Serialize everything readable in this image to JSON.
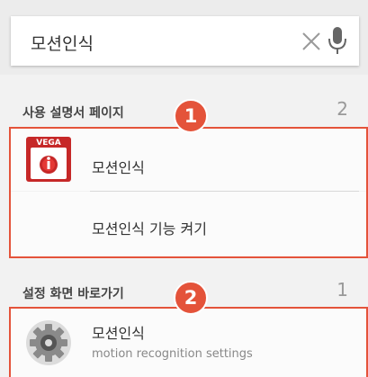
{
  "search": {
    "query": "모션인식"
  },
  "sections": [
    {
      "title": "사용 설명서 페이지",
      "count": "2",
      "badge": "1",
      "items": [
        {
          "label": "모션인식",
          "icon": "vega-manual-icon",
          "icon_text": "VEGA"
        },
        {
          "label": "모션인식 기능 켜기"
        }
      ]
    },
    {
      "title": "설정 화면 바로가기",
      "count": "1",
      "badge": "2",
      "items": [
        {
          "label": "모션인식",
          "sub": "motion recognition settings",
          "icon": "settings-gear-icon"
        }
      ]
    }
  ],
  "colors": {
    "accent": "#e4533a",
    "background": "#f2f2f2"
  }
}
